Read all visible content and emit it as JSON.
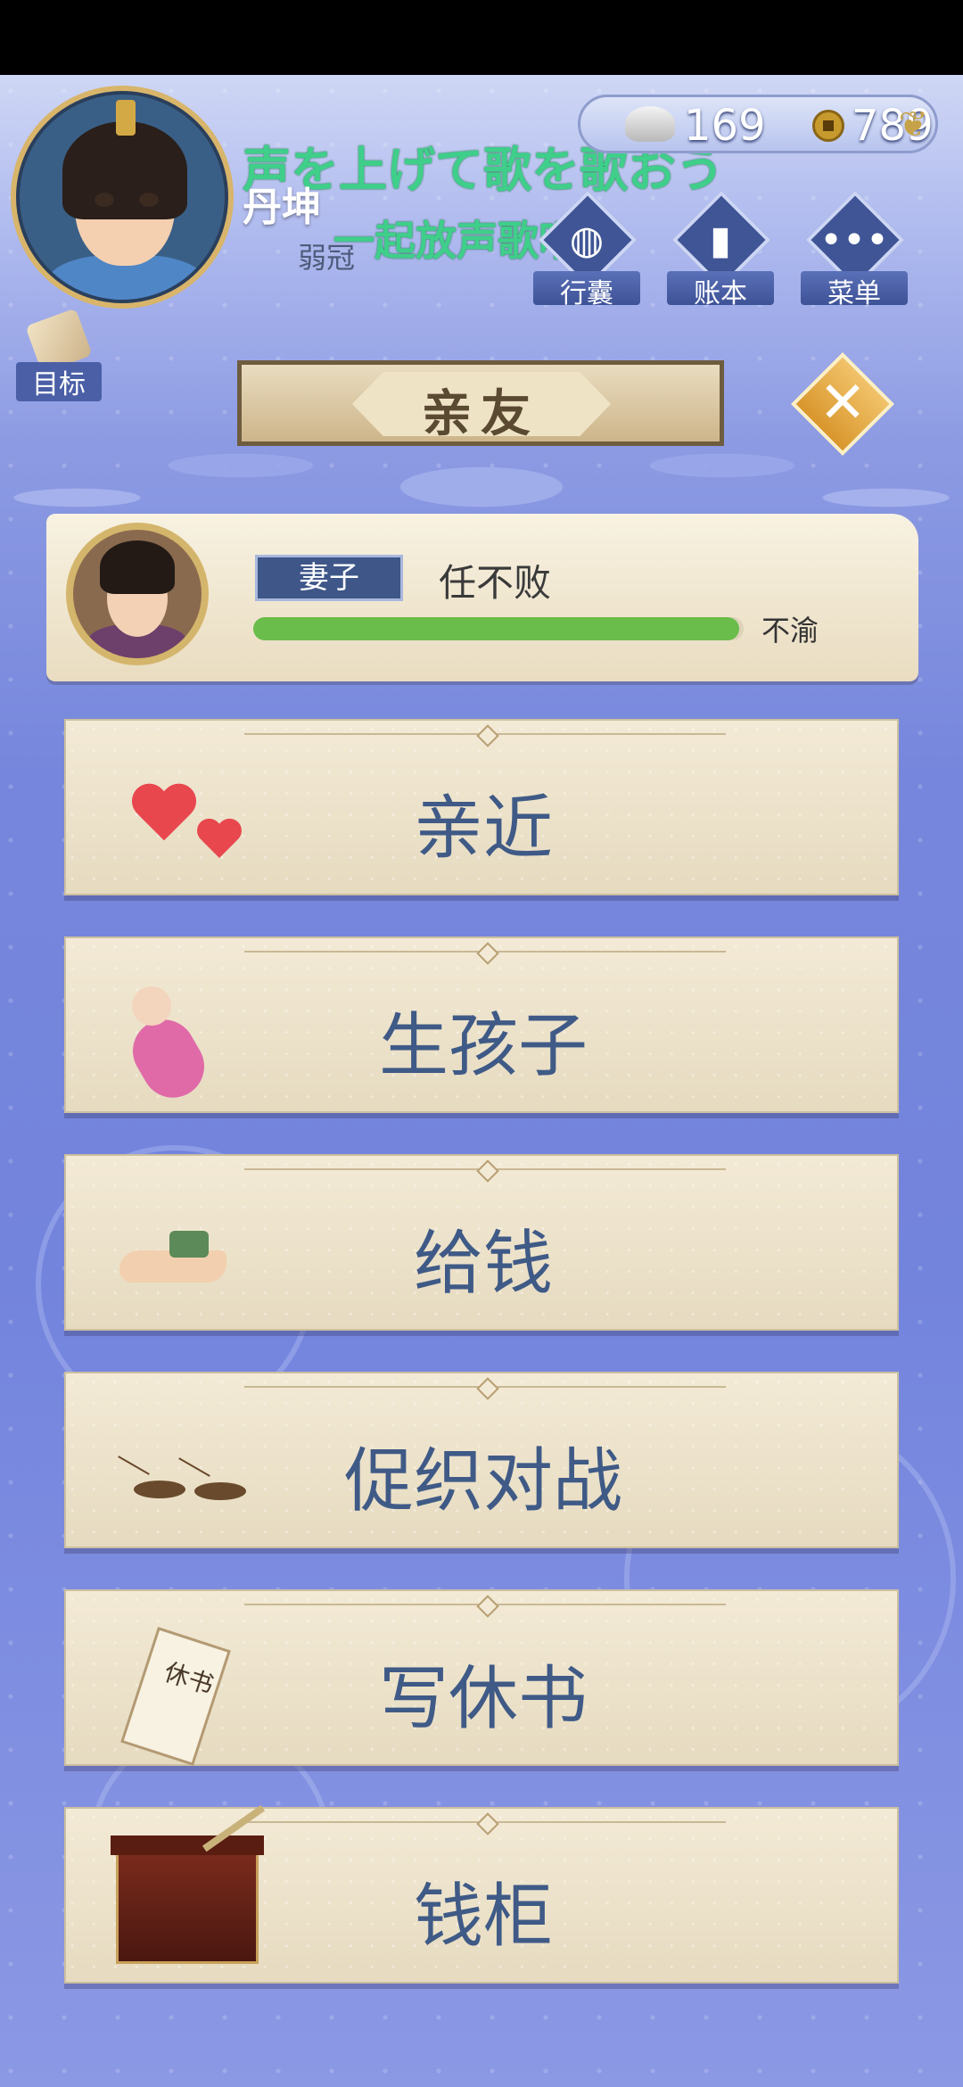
{
  "header": {
    "player_name": "丹坤",
    "player_age_title": "弱冠",
    "lyric_line_1": "声を上げて歌を歌おう",
    "lyric_line_2": "一起放声歌唱吧",
    "silver_value": "169",
    "copper_value": "789",
    "buttons": [
      {
        "label": "行囊",
        "icon": "bag-icon"
      },
      {
        "label": "账本",
        "icon": "ledger-icon"
      },
      {
        "label": "菜单",
        "icon": "more-icon"
      }
    ],
    "target_label": "目标"
  },
  "panel": {
    "title": "亲友",
    "close_icon": "close-icon"
  },
  "relation": {
    "role": "妻子",
    "name": "任不败",
    "mood_label": "不渝",
    "mood_level": 0.99,
    "mood_color": "#6abd4a"
  },
  "actions": [
    {
      "label": "亲近",
      "icon": "hearts-icon"
    },
    {
      "label": "生孩子",
      "icon": "baby-icon"
    },
    {
      "label": "给钱",
      "icon": "money-hand-icon"
    },
    {
      "label": "促织对战",
      "icon": "cricket-icon"
    },
    {
      "label": "写休书",
      "icon": "divorce-letter-icon"
    },
    {
      "label": "钱柜",
      "icon": "money-chest-icon"
    }
  ],
  "icons": {
    "divorce_letter_text": "休书"
  },
  "colors": {
    "accent": "#3f5a86",
    "background": "#7686dc",
    "lyric": "#3fcf8a"
  }
}
